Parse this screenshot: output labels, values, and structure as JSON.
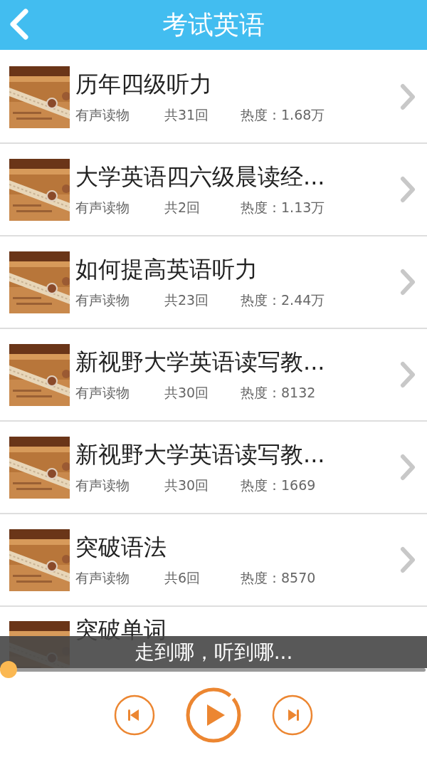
{
  "header": {
    "title": "考试英语"
  },
  "items": [
    {
      "title": "历年四级听力",
      "type": "有声读物",
      "episodes": "共31回",
      "popularity": "热度：1.68万"
    },
    {
      "title": "大学英语四六级晨读经...",
      "type": "有声读物",
      "episodes": "共2回",
      "popularity": "热度：1.13万"
    },
    {
      "title": "如何提高英语听力",
      "type": "有声读物",
      "episodes": "共23回",
      "popularity": "热度：2.44万"
    },
    {
      "title": "新视野大学英语读写教...",
      "type": "有声读物",
      "episodes": "共30回",
      "popularity": "热度：8132"
    },
    {
      "title": "新视野大学英语读写教...",
      "type": "有声读物",
      "episodes": "共30回",
      "popularity": "热度：1669"
    },
    {
      "title": "突破语法",
      "type": "有声读物",
      "episodes": "共6回",
      "popularity": "热度：8570"
    },
    {
      "title": "突破单词"
    }
  ],
  "player": {
    "caption": "走到哪，听到哪...",
    "progress": {
      "level": 0
    }
  }
}
